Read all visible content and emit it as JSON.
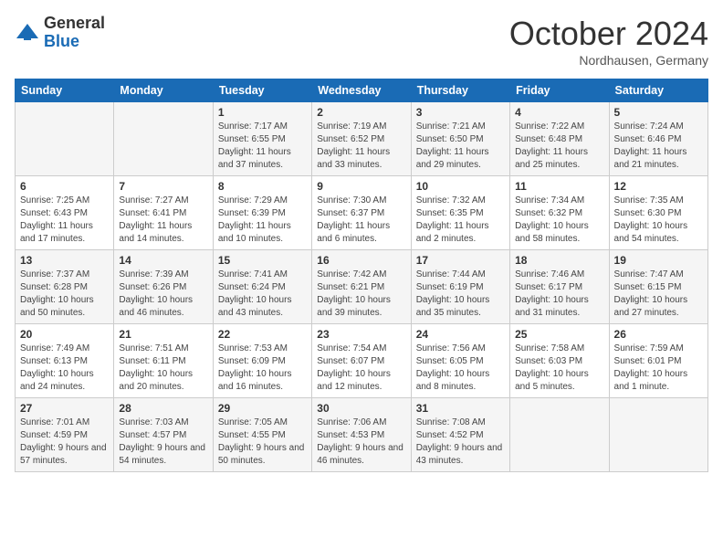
{
  "header": {
    "logo_general": "General",
    "logo_blue": "Blue",
    "month_title": "October 2024",
    "location": "Nordhausen, Germany"
  },
  "days": [
    "Sunday",
    "Monday",
    "Tuesday",
    "Wednesday",
    "Thursday",
    "Friday",
    "Saturday"
  ],
  "weeks": [
    [
      {
        "date": "",
        "info": ""
      },
      {
        "date": "",
        "info": ""
      },
      {
        "date": "1",
        "info": "Sunrise: 7:17 AM\nSunset: 6:55 PM\nDaylight: 11 hours and 37 minutes."
      },
      {
        "date": "2",
        "info": "Sunrise: 7:19 AM\nSunset: 6:52 PM\nDaylight: 11 hours and 33 minutes."
      },
      {
        "date": "3",
        "info": "Sunrise: 7:21 AM\nSunset: 6:50 PM\nDaylight: 11 hours and 29 minutes."
      },
      {
        "date": "4",
        "info": "Sunrise: 7:22 AM\nSunset: 6:48 PM\nDaylight: 11 hours and 25 minutes."
      },
      {
        "date": "5",
        "info": "Sunrise: 7:24 AM\nSunset: 6:46 PM\nDaylight: 11 hours and 21 minutes."
      }
    ],
    [
      {
        "date": "6",
        "info": "Sunrise: 7:25 AM\nSunset: 6:43 PM\nDaylight: 11 hours and 17 minutes."
      },
      {
        "date": "7",
        "info": "Sunrise: 7:27 AM\nSunset: 6:41 PM\nDaylight: 11 hours and 14 minutes."
      },
      {
        "date": "8",
        "info": "Sunrise: 7:29 AM\nSunset: 6:39 PM\nDaylight: 11 hours and 10 minutes."
      },
      {
        "date": "9",
        "info": "Sunrise: 7:30 AM\nSunset: 6:37 PM\nDaylight: 11 hours and 6 minutes."
      },
      {
        "date": "10",
        "info": "Sunrise: 7:32 AM\nSunset: 6:35 PM\nDaylight: 11 hours and 2 minutes."
      },
      {
        "date": "11",
        "info": "Sunrise: 7:34 AM\nSunset: 6:32 PM\nDaylight: 10 hours and 58 minutes."
      },
      {
        "date": "12",
        "info": "Sunrise: 7:35 AM\nSunset: 6:30 PM\nDaylight: 10 hours and 54 minutes."
      }
    ],
    [
      {
        "date": "13",
        "info": "Sunrise: 7:37 AM\nSunset: 6:28 PM\nDaylight: 10 hours and 50 minutes."
      },
      {
        "date": "14",
        "info": "Sunrise: 7:39 AM\nSunset: 6:26 PM\nDaylight: 10 hours and 46 minutes."
      },
      {
        "date": "15",
        "info": "Sunrise: 7:41 AM\nSunset: 6:24 PM\nDaylight: 10 hours and 43 minutes."
      },
      {
        "date": "16",
        "info": "Sunrise: 7:42 AM\nSunset: 6:21 PM\nDaylight: 10 hours and 39 minutes."
      },
      {
        "date": "17",
        "info": "Sunrise: 7:44 AM\nSunset: 6:19 PM\nDaylight: 10 hours and 35 minutes."
      },
      {
        "date": "18",
        "info": "Sunrise: 7:46 AM\nSunset: 6:17 PM\nDaylight: 10 hours and 31 minutes."
      },
      {
        "date": "19",
        "info": "Sunrise: 7:47 AM\nSunset: 6:15 PM\nDaylight: 10 hours and 27 minutes."
      }
    ],
    [
      {
        "date": "20",
        "info": "Sunrise: 7:49 AM\nSunset: 6:13 PM\nDaylight: 10 hours and 24 minutes."
      },
      {
        "date": "21",
        "info": "Sunrise: 7:51 AM\nSunset: 6:11 PM\nDaylight: 10 hours and 20 minutes."
      },
      {
        "date": "22",
        "info": "Sunrise: 7:53 AM\nSunset: 6:09 PM\nDaylight: 10 hours and 16 minutes."
      },
      {
        "date": "23",
        "info": "Sunrise: 7:54 AM\nSunset: 6:07 PM\nDaylight: 10 hours and 12 minutes."
      },
      {
        "date": "24",
        "info": "Sunrise: 7:56 AM\nSunset: 6:05 PM\nDaylight: 10 hours and 8 minutes."
      },
      {
        "date": "25",
        "info": "Sunrise: 7:58 AM\nSunset: 6:03 PM\nDaylight: 10 hours and 5 minutes."
      },
      {
        "date": "26",
        "info": "Sunrise: 7:59 AM\nSunset: 6:01 PM\nDaylight: 10 hours and 1 minute."
      }
    ],
    [
      {
        "date": "27",
        "info": "Sunrise: 7:01 AM\nSunset: 4:59 PM\nDaylight: 9 hours and 57 minutes."
      },
      {
        "date": "28",
        "info": "Sunrise: 7:03 AM\nSunset: 4:57 PM\nDaylight: 9 hours and 54 minutes."
      },
      {
        "date": "29",
        "info": "Sunrise: 7:05 AM\nSunset: 4:55 PM\nDaylight: 9 hours and 50 minutes."
      },
      {
        "date": "30",
        "info": "Sunrise: 7:06 AM\nSunset: 4:53 PM\nDaylight: 9 hours and 46 minutes."
      },
      {
        "date": "31",
        "info": "Sunrise: 7:08 AM\nSunset: 4:52 PM\nDaylight: 9 hours and 43 minutes."
      },
      {
        "date": "",
        "info": ""
      },
      {
        "date": "",
        "info": ""
      }
    ]
  ]
}
